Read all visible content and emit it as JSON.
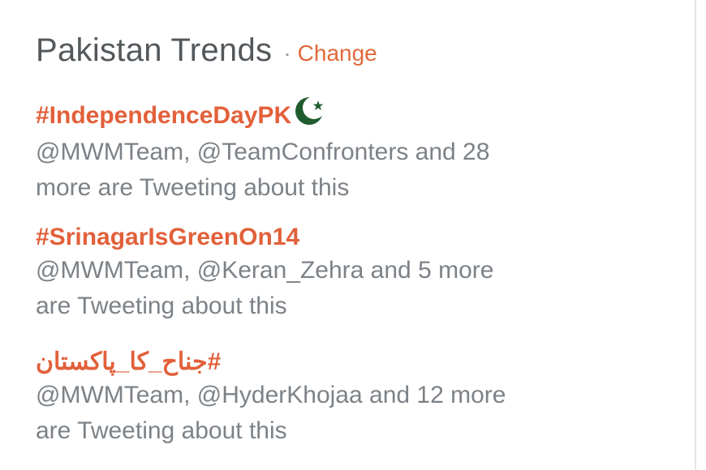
{
  "header": {
    "title": "Pakistan Trends",
    "separator": "·",
    "change_label": "Change"
  },
  "trends": [
    {
      "hashtag": "#IndependenceDayPK",
      "icon": "pakistan-flag-icon",
      "context_line1": "@MWMTeam, @TeamConfronters and 28",
      "context_line2": "more are Tweeting about this"
    },
    {
      "hashtag": "#SrinagarIsGreenOn14",
      "context_line1": "@MWMTeam, @Keran_Zehra and 5 more",
      "context_line2": "are Tweeting about this"
    },
    {
      "hashtag": "#جناح_کا_پاکستان",
      "context_line1": "@MWMTeam, @HyderKhojaa and 12 more",
      "context_line2": "are Tweeting about this"
    }
  ],
  "colors": {
    "accent": "#e06a3b",
    "title": "#53585c",
    "muted": "#7c8287",
    "flag_green": "#1e5c2e"
  }
}
